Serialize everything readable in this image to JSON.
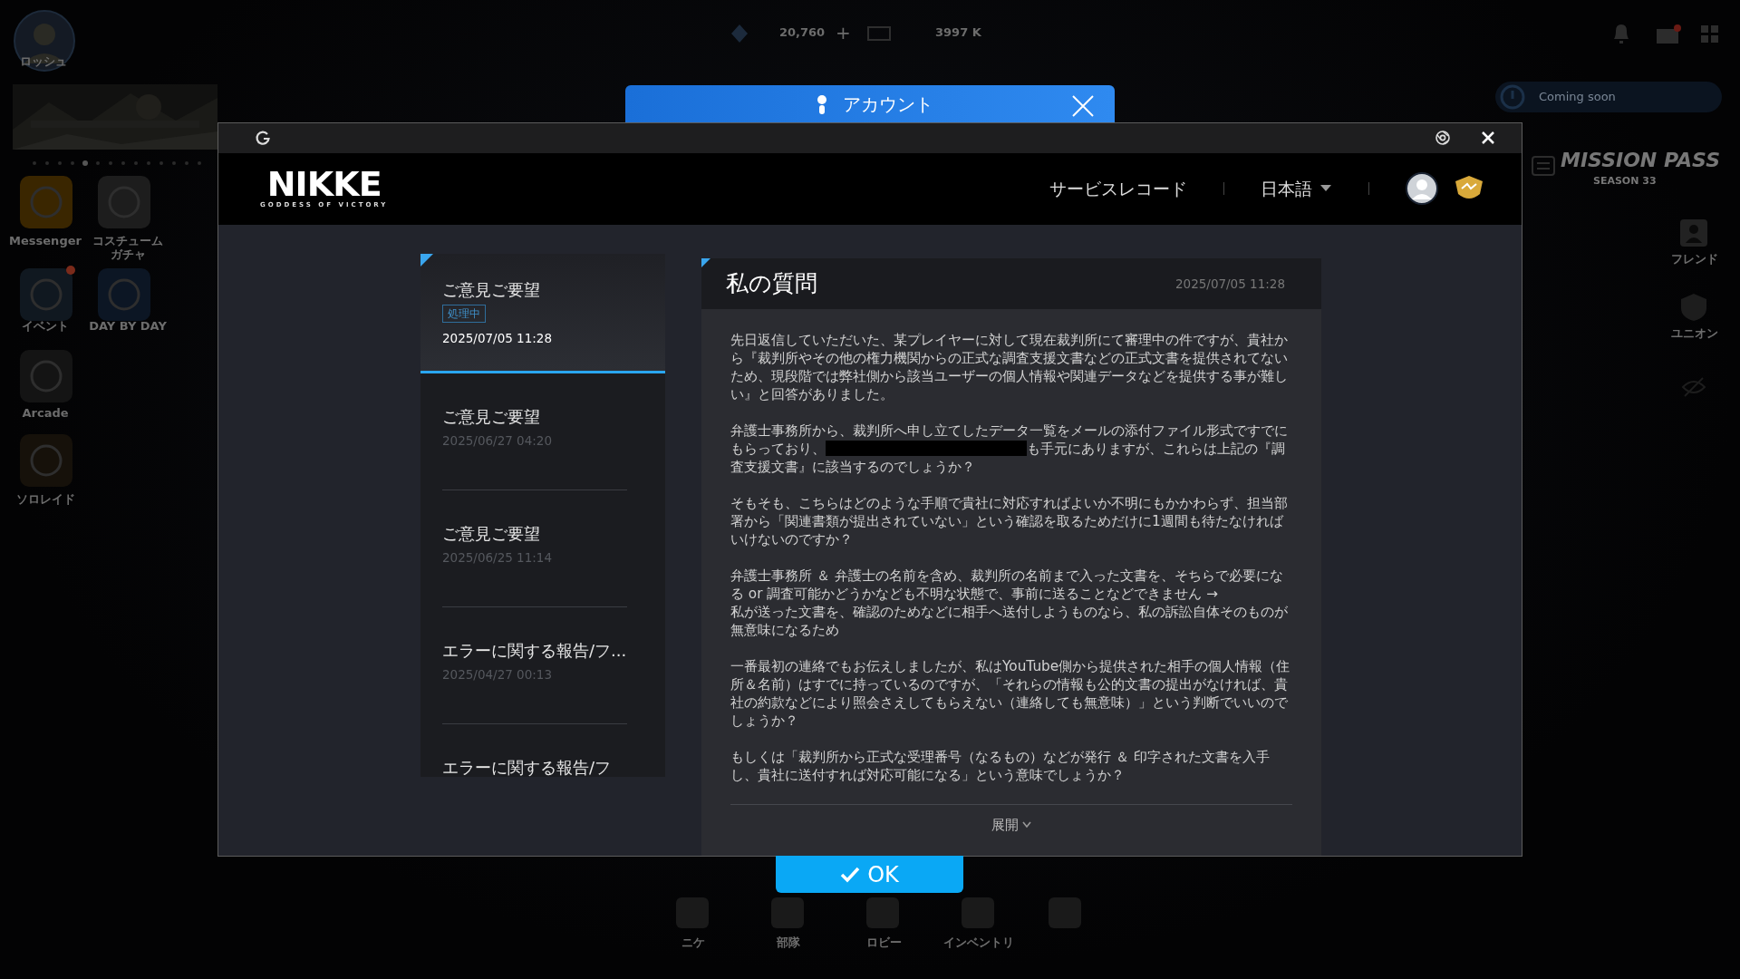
{
  "game_background": {
    "profile_name": "ロッシュ",
    "top_bar": {
      "gems": "20,760",
      "gems_plus": "+",
      "credits": "3997 K"
    },
    "left_menu": [
      {
        "label": "Messenger",
        "badge": false
      },
      {
        "label": "コスチュームガチャ",
        "badge": false
      },
      {
        "label": "イベント",
        "badge": true
      },
      {
        "label": "DAY BY DAY",
        "badge": false
      },
      {
        "label": "Arcade",
        "badge": false
      },
      {
        "label": "ソロレイド",
        "badge": false
      }
    ],
    "coming_soon": "Coming soon",
    "mission_pass": {
      "title": "MISSION PASS",
      "season": "SEASON 33"
    },
    "right_menu": [
      {
        "label": "フレンド"
      },
      {
        "label": "ユニオン"
      }
    ],
    "bottom_nav": [
      {
        "label": "ニケ"
      },
      {
        "label": "部隊"
      },
      {
        "label": "ロビー"
      },
      {
        "label": "インベントリ"
      }
    ],
    "popup_title": "アカウント"
  },
  "dialog": {
    "logo": {
      "title": "NIKKE",
      "subtitle": "GODDESS OF VICTORY"
    },
    "nav": {
      "service_record": "サービスレコード",
      "language": "日本語"
    },
    "tickets": [
      {
        "title": "ご意見ご要望",
        "status": "処理中",
        "date": "2025/07/05 11:28",
        "selected": true
      },
      {
        "title": "ご意見ご要望",
        "date": "2025/06/27 04:20",
        "selected": false
      },
      {
        "title": "ご意見ご要望",
        "date": "2025/06/25 11:14",
        "selected": false
      },
      {
        "title": "エラーに関する報告/フ...",
        "date": "2025/04/27 00:13",
        "selected": false
      },
      {
        "title": "エラーに関する報告/フ",
        "selected": false
      }
    ],
    "detail": {
      "title": "私の質問",
      "date": "2025/07/05 11:28",
      "paragraphs": [
        {
          "segments": [
            {
              "kind": "text",
              "text": "先日返信していただいた、某プレイヤーに対して現在裁判所にて審理中の件ですが、貴社から『裁判所やその他の権力機関からの正式な調査支援文書などの正式文書を提供されてないため、現段階では弊社側から該当ユーザーの個人情報や関連データなどを提供する事が難しい』と回答がありました。"
            }
          ]
        },
        {
          "segments": [
            {
              "kind": "text",
              "text": "弁護士事務所から、裁判所へ申し立てしたデータ一覧をメールの添付ファイル形式ですでにもらっており、"
            },
            {
              "kind": "redaction"
            },
            {
              "kind": "text",
              "text": "も手元にありますが、これらは上記の『調査支援文書』に該当するのでしょうか？"
            }
          ]
        },
        {
          "segments": [
            {
              "kind": "text",
              "text": "そもそも、こちらはどのような手順で貴社に対応すればよいか不明にもかかわらず、担当部署から「関連書類が提出されていない」という確認を取るためだけに1週間も待たなければいけないのですか？"
            }
          ]
        },
        {
          "segments": [
            {
              "kind": "text",
              "text": "弁護士事務所 ＆ 弁護士の名前を含め、裁判所の名前まで入った文書を、そちらで必要になる or 調査可能かどうかなども不明な状態で、事前に送ることなどできません →\n私が送った文書を、確認のためなどに相手へ送付しようものなら、私の訴訟自体そのものが無意味になるため"
            }
          ]
        },
        {
          "segments": [
            {
              "kind": "text",
              "text": "一番最初の連絡でもお伝えしましたが、私はYouTube側から提供された相手の個人情報（住所＆名前）はすでに持っているのですが、「それらの情報も公的文書の提出がなければ、貴社の約款などにより照会さえしてもらえない（連絡しても無意味）」という判断でいいのでしょうか？"
            }
          ]
        },
        {
          "segments": [
            {
              "kind": "text",
              "text": "もしくは「裁判所から正式な受理番号（なるもの）などが発行 ＆ 印字された文書を入手し、貴社に送付すれば対応可能になる」という意味でしょうか？"
            }
          ]
        }
      ],
      "expand": "展開"
    }
  },
  "ok_button": "OK"
}
